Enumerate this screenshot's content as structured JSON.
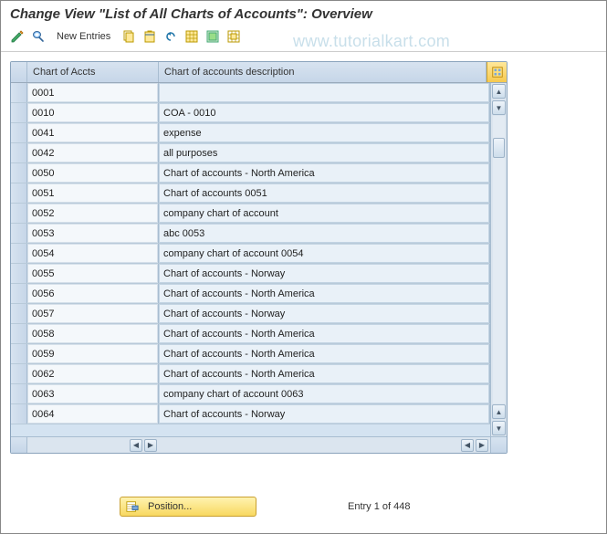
{
  "title": "Change View \"List of All Charts of Accounts\": Overview",
  "toolbar": {
    "new_entries_label": "New Entries"
  },
  "watermark": "www.tutorialkart.com",
  "table": {
    "columns": {
      "code": "Chart of Accts",
      "desc": "Chart of accounts description"
    },
    "rows": [
      {
        "code": "0001",
        "desc": ""
      },
      {
        "code": "0010",
        "desc": "COA - 0010"
      },
      {
        "code": "0041",
        "desc": "expense"
      },
      {
        "code": "0042",
        "desc": "all purposes"
      },
      {
        "code": "0050",
        "desc": "Chart of accounts - North America"
      },
      {
        "code": "0051",
        "desc": "Chart of accounts 0051"
      },
      {
        "code": "0052",
        "desc": "company chart of account"
      },
      {
        "code": "0053",
        "desc": "abc 0053"
      },
      {
        "code": "0054",
        "desc": "company chart of account 0054"
      },
      {
        "code": "0055",
        "desc": "Chart of accounts - Norway"
      },
      {
        "code": "0056",
        "desc": "Chart of accounts - North America"
      },
      {
        "code": "0057",
        "desc": "Chart of accounts - Norway"
      },
      {
        "code": "0058",
        "desc": "Chart of accounts - North America"
      },
      {
        "code": "0059",
        "desc": "Chart of accounts - North America"
      },
      {
        "code": "0062",
        "desc": "Chart of accounts - North America"
      },
      {
        "code": "0063",
        "desc": "company chart of account 0063"
      },
      {
        "code": "0064",
        "desc": "Chart of accounts - Norway"
      }
    ]
  },
  "footer": {
    "position_label": "Position...",
    "entry_text": "Entry 1 of 448"
  }
}
